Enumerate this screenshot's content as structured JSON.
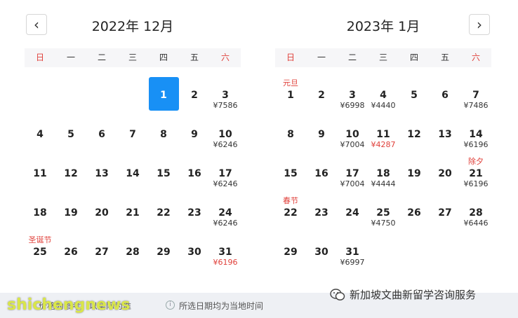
{
  "nav": {
    "prev_icon": "‹",
    "next_icon": "›"
  },
  "weekdays": [
    "日",
    "一",
    "二",
    "三",
    "四",
    "五",
    "六"
  ],
  "months": [
    {
      "title": "2022年 12月",
      "leading_blanks": 4,
      "selected_day": 1,
      "days": [
        {
          "d": "1",
          "p": ""
        },
        {
          "d": "2",
          "p": ""
        },
        {
          "d": "3",
          "p": "¥7586"
        },
        {
          "d": "4",
          "p": ""
        },
        {
          "d": "5",
          "p": ""
        },
        {
          "d": "6",
          "p": ""
        },
        {
          "d": "7",
          "p": ""
        },
        {
          "d": "8",
          "p": ""
        },
        {
          "d": "9",
          "p": ""
        },
        {
          "d": "10",
          "p": "¥6246"
        },
        {
          "d": "11",
          "p": ""
        },
        {
          "d": "12",
          "p": ""
        },
        {
          "d": "13",
          "p": ""
        },
        {
          "d": "14",
          "p": ""
        },
        {
          "d": "15",
          "p": ""
        },
        {
          "d": "16",
          "p": ""
        },
        {
          "d": "17",
          "p": "¥6246"
        },
        {
          "d": "18",
          "p": ""
        },
        {
          "d": "19",
          "p": ""
        },
        {
          "d": "20",
          "p": ""
        },
        {
          "d": "21",
          "p": ""
        },
        {
          "d": "22",
          "p": ""
        },
        {
          "d": "23",
          "p": ""
        },
        {
          "d": "24",
          "p": "¥6246"
        },
        {
          "d": "25",
          "p": "",
          "h": "圣诞节"
        },
        {
          "d": "26",
          "p": ""
        },
        {
          "d": "27",
          "p": ""
        },
        {
          "d": "28",
          "p": ""
        },
        {
          "d": "29",
          "p": ""
        },
        {
          "d": "30",
          "p": ""
        },
        {
          "d": "31",
          "p": "¥6196",
          "low": true
        }
      ]
    },
    {
      "title": "2023年 1月",
      "leading_blanks": 0,
      "selected_day": null,
      "days": [
        {
          "d": "1",
          "p": "",
          "h": "元旦"
        },
        {
          "d": "2",
          "p": ""
        },
        {
          "d": "3",
          "p": "¥6998"
        },
        {
          "d": "4",
          "p": "¥4440"
        },
        {
          "d": "5",
          "p": ""
        },
        {
          "d": "6",
          "p": ""
        },
        {
          "d": "7",
          "p": "¥7486"
        },
        {
          "d": "8",
          "p": ""
        },
        {
          "d": "9",
          "p": ""
        },
        {
          "d": "10",
          "p": "¥7004"
        },
        {
          "d": "11",
          "p": "¥4287",
          "low": true
        },
        {
          "d": "12",
          "p": ""
        },
        {
          "d": "13",
          "p": ""
        },
        {
          "d": "14",
          "p": "¥6196"
        },
        {
          "d": "15",
          "p": ""
        },
        {
          "d": "16",
          "p": ""
        },
        {
          "d": "17",
          "p": "¥7004"
        },
        {
          "d": "18",
          "p": "¥4444"
        },
        {
          "d": "19",
          "p": ""
        },
        {
          "d": "20",
          "p": ""
        },
        {
          "d": "21",
          "p": "¥6196",
          "h": "除夕"
        },
        {
          "d": "22",
          "p": "",
          "h": "春节"
        },
        {
          "d": "23",
          "p": ""
        },
        {
          "d": "24",
          "p": ""
        },
        {
          "d": "25",
          "p": "¥4750"
        },
        {
          "d": "26",
          "p": ""
        },
        {
          "d": "27",
          "p": ""
        },
        {
          "d": "28",
          "p": "¥6446"
        },
        {
          "d": "29",
          "p": ""
        },
        {
          "d": "30",
          "p": ""
        },
        {
          "d": "31",
          "p": "¥6997"
        }
      ]
    }
  ],
  "footer": {
    "note_1": "价格为参考，以实际为准",
    "info_icon": "i",
    "note_2": "所选日期均为当地时间"
  },
  "watermark": {
    "left_text": "shichengnews",
    "right_text": "新加坡文曲新留学咨询服务"
  },
  "colors": {
    "accent": "#1890f5",
    "weekend": "#e0403a",
    "low_price": "#e0403a"
  }
}
